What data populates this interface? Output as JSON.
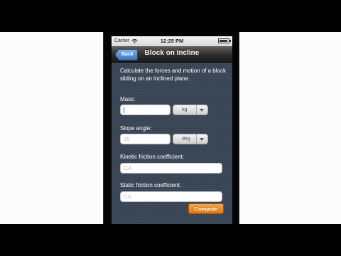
{
  "status_bar": {
    "carrier": "Carrier",
    "time": "12:25 PM"
  },
  "nav": {
    "back_label": "Back",
    "title": "Block on Incline"
  },
  "description": "Calculate the forces and motion of a block sliding on an inclined plane.",
  "fields": {
    "mass": {
      "label": "Mass:",
      "value": "",
      "unit": "kg"
    },
    "slope": {
      "label": "Slope angle:",
      "placeholder": "35",
      "unit": "deg"
    },
    "kinetic": {
      "label": "Kinetic friction coefficient:",
      "placeholder": "0.4"
    },
    "static": {
      "label": "Static friction coefficient:",
      "placeholder": "0.6"
    }
  },
  "compute_label": "Compute",
  "colors": {
    "accent": "#e07512",
    "nav_back": "#3d77c4",
    "background": "#3a4656"
  }
}
